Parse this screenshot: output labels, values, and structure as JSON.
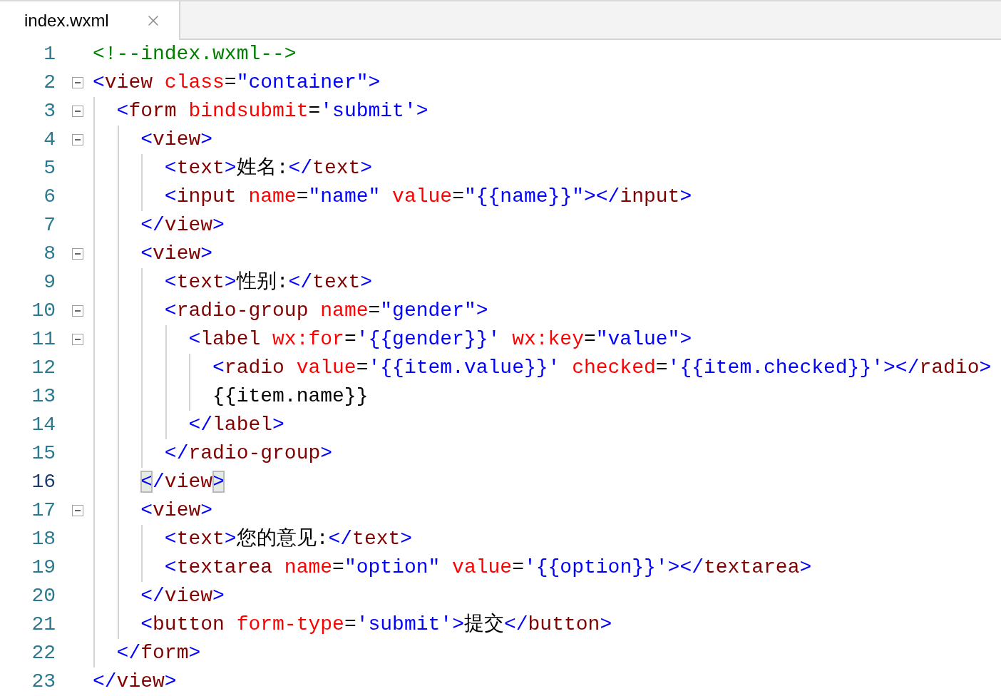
{
  "tab": {
    "title": "index.wxml",
    "selected": true
  },
  "lines": [
    {
      "number": "1",
      "fold": false,
      "current": false,
      "tokens": [
        {
          "kind": "comment",
          "text": "<!--index.wxml-->"
        }
      ]
    },
    {
      "number": "2",
      "fold": true,
      "current": false,
      "tokens": [
        {
          "kind": "punct",
          "text": "<"
        },
        {
          "kind": "tag",
          "text": "view"
        },
        {
          "kind": "attr",
          "text": " class"
        },
        {
          "kind": "plain",
          "text": "="
        },
        {
          "kind": "value",
          "text": "\"container\""
        },
        {
          "kind": "punct",
          "text": ">"
        }
      ]
    },
    {
      "number": "3",
      "fold": true,
      "current": false,
      "tokens": [
        {
          "kind": "punct",
          "text": "  <"
        },
        {
          "kind": "tag",
          "text": "form"
        },
        {
          "kind": "attr",
          "text": " bindsubmit"
        },
        {
          "kind": "plain",
          "text": "="
        },
        {
          "kind": "value",
          "text": "'submit'"
        },
        {
          "kind": "punct",
          "text": ">"
        }
      ]
    },
    {
      "number": "4",
      "fold": true,
      "current": false,
      "tokens": [
        {
          "kind": "punct",
          "text": "    <"
        },
        {
          "kind": "tag",
          "text": "view"
        },
        {
          "kind": "punct",
          "text": ">"
        }
      ]
    },
    {
      "number": "5",
      "fold": false,
      "current": false,
      "tokens": [
        {
          "kind": "punct",
          "text": "      <"
        },
        {
          "kind": "tag",
          "text": "text"
        },
        {
          "kind": "punct",
          "text": ">"
        },
        {
          "kind": "plain",
          "text": "姓名:"
        },
        {
          "kind": "punct",
          "text": "</"
        },
        {
          "kind": "tag",
          "text": "text"
        },
        {
          "kind": "punct",
          "text": ">"
        }
      ]
    },
    {
      "number": "6",
      "fold": false,
      "current": false,
      "tokens": [
        {
          "kind": "punct",
          "text": "      <"
        },
        {
          "kind": "tag",
          "text": "input"
        },
        {
          "kind": "attr",
          "text": " name"
        },
        {
          "kind": "plain",
          "text": "="
        },
        {
          "kind": "value",
          "text": "\"name\""
        },
        {
          "kind": "attr",
          "text": " value"
        },
        {
          "kind": "plain",
          "text": "="
        },
        {
          "kind": "value",
          "text": "\"{{name}}\""
        },
        {
          "kind": "punct",
          "text": "></"
        },
        {
          "kind": "tag",
          "text": "input"
        },
        {
          "kind": "punct",
          "text": ">"
        }
      ]
    },
    {
      "number": "7",
      "fold": false,
      "current": false,
      "tokens": [
        {
          "kind": "punct",
          "text": "    </"
        },
        {
          "kind": "tag",
          "text": "view"
        },
        {
          "kind": "punct",
          "text": ">"
        }
      ]
    },
    {
      "number": "8",
      "fold": true,
      "current": false,
      "tokens": [
        {
          "kind": "punct",
          "text": "    <"
        },
        {
          "kind": "tag",
          "text": "view"
        },
        {
          "kind": "punct",
          "text": ">"
        }
      ]
    },
    {
      "number": "9",
      "fold": false,
      "current": false,
      "tokens": [
        {
          "kind": "punct",
          "text": "      <"
        },
        {
          "kind": "tag",
          "text": "text"
        },
        {
          "kind": "punct",
          "text": ">"
        },
        {
          "kind": "plain",
          "text": "性别:"
        },
        {
          "kind": "punct",
          "text": "</"
        },
        {
          "kind": "tag",
          "text": "text"
        },
        {
          "kind": "punct",
          "text": ">"
        }
      ]
    },
    {
      "number": "10",
      "fold": true,
      "current": false,
      "tokens": [
        {
          "kind": "punct",
          "text": "      <"
        },
        {
          "kind": "tag",
          "text": "radio-group"
        },
        {
          "kind": "attr",
          "text": " name"
        },
        {
          "kind": "plain",
          "text": "="
        },
        {
          "kind": "value",
          "text": "\"gender\""
        },
        {
          "kind": "punct",
          "text": ">"
        }
      ]
    },
    {
      "number": "11",
      "fold": true,
      "current": false,
      "tokens": [
        {
          "kind": "punct",
          "text": "        <"
        },
        {
          "kind": "tag",
          "text": "label"
        },
        {
          "kind": "attr",
          "text": " wx:for"
        },
        {
          "kind": "plain",
          "text": "="
        },
        {
          "kind": "value",
          "text": "'{{gender}}'"
        },
        {
          "kind": "attr",
          "text": " wx:key"
        },
        {
          "kind": "plain",
          "text": "="
        },
        {
          "kind": "value",
          "text": "\"value\""
        },
        {
          "kind": "punct",
          "text": ">"
        }
      ]
    },
    {
      "number": "12",
      "fold": false,
      "current": false,
      "tokens": [
        {
          "kind": "punct",
          "text": "          <"
        },
        {
          "kind": "tag",
          "text": "radio"
        },
        {
          "kind": "attr",
          "text": " value"
        },
        {
          "kind": "plain",
          "text": "="
        },
        {
          "kind": "value",
          "text": "'{{item.value}}'"
        },
        {
          "kind": "attr",
          "text": " checked"
        },
        {
          "kind": "plain",
          "text": "="
        },
        {
          "kind": "value",
          "text": "'{{item.checked}}'"
        },
        {
          "kind": "punct",
          "text": "></"
        },
        {
          "kind": "tag",
          "text": "radio"
        },
        {
          "kind": "punct",
          "text": ">"
        }
      ]
    },
    {
      "number": "13",
      "fold": false,
      "current": false,
      "tokens": [
        {
          "kind": "plain",
          "text": "          {{item.name}}"
        }
      ]
    },
    {
      "number": "14",
      "fold": false,
      "current": false,
      "tokens": [
        {
          "kind": "punct",
          "text": "        </"
        },
        {
          "kind": "tag",
          "text": "label"
        },
        {
          "kind": "punct",
          "text": ">"
        }
      ]
    },
    {
      "number": "15",
      "fold": false,
      "current": false,
      "tokens": [
        {
          "kind": "punct",
          "text": "      </"
        },
        {
          "kind": "tag",
          "text": "radio-group"
        },
        {
          "kind": "punct",
          "text": ">"
        }
      ]
    },
    {
      "number": "16",
      "fold": false,
      "current": true,
      "tokens": [
        {
          "kind": "punct",
          "text": "    <"
        },
        {
          "kind": "punct",
          "text": "/"
        },
        {
          "kind": "tag",
          "text": "view"
        },
        {
          "kind": "punct",
          "text": ">"
        }
      ]
    },
    {
      "number": "17",
      "fold": true,
      "current": false,
      "tokens": [
        {
          "kind": "punct",
          "text": "    <"
        },
        {
          "kind": "tag",
          "text": "view"
        },
        {
          "kind": "punct",
          "text": ">"
        }
      ]
    },
    {
      "number": "18",
      "fold": false,
      "current": false,
      "tokens": [
        {
          "kind": "punct",
          "text": "      <"
        },
        {
          "kind": "tag",
          "text": "text"
        },
        {
          "kind": "punct",
          "text": ">"
        },
        {
          "kind": "plain",
          "text": "您的意见:"
        },
        {
          "kind": "punct",
          "text": "</"
        },
        {
          "kind": "tag",
          "text": "text"
        },
        {
          "kind": "punct",
          "text": ">"
        }
      ]
    },
    {
      "number": "19",
      "fold": false,
      "current": false,
      "tokens": [
        {
          "kind": "punct",
          "text": "      <"
        },
        {
          "kind": "tag",
          "text": "textarea"
        },
        {
          "kind": "attr",
          "text": " name"
        },
        {
          "kind": "plain",
          "text": "="
        },
        {
          "kind": "value",
          "text": "\"option\""
        },
        {
          "kind": "attr",
          "text": " value"
        },
        {
          "kind": "plain",
          "text": "="
        },
        {
          "kind": "value",
          "text": "'{{option}}'"
        },
        {
          "kind": "punct",
          "text": "></"
        },
        {
          "kind": "tag",
          "text": "textarea"
        },
        {
          "kind": "punct",
          "text": ">"
        }
      ]
    },
    {
      "number": "20",
      "fold": false,
      "current": false,
      "tokens": [
        {
          "kind": "punct",
          "text": "    </"
        },
        {
          "kind": "tag",
          "text": "view"
        },
        {
          "kind": "punct",
          "text": ">"
        }
      ]
    },
    {
      "number": "21",
      "fold": false,
      "current": false,
      "tokens": [
        {
          "kind": "punct",
          "text": "    <"
        },
        {
          "kind": "tag",
          "text": "button"
        },
        {
          "kind": "attr",
          "text": " form-type"
        },
        {
          "kind": "plain",
          "text": "="
        },
        {
          "kind": "value",
          "text": "'submit'"
        },
        {
          "kind": "punct",
          "text": ">"
        },
        {
          "kind": "plain",
          "text": "提交"
        },
        {
          "kind": "punct",
          "text": "</"
        },
        {
          "kind": "tag",
          "text": "button"
        },
        {
          "kind": "punct",
          "text": ">"
        }
      ]
    },
    {
      "number": "22",
      "fold": false,
      "current": false,
      "tokens": [
        {
          "kind": "punct",
          "text": "  </"
        },
        {
          "kind": "tag",
          "text": "form"
        },
        {
          "kind": "punct",
          "text": ">"
        }
      ]
    },
    {
      "number": "23",
      "fold": false,
      "current": false,
      "tokens": [
        {
          "kind": "punct",
          "text": "</"
        },
        {
          "kind": "tag",
          "text": "view"
        },
        {
          "kind": "punct",
          "text": ">"
        }
      ]
    }
  ]
}
